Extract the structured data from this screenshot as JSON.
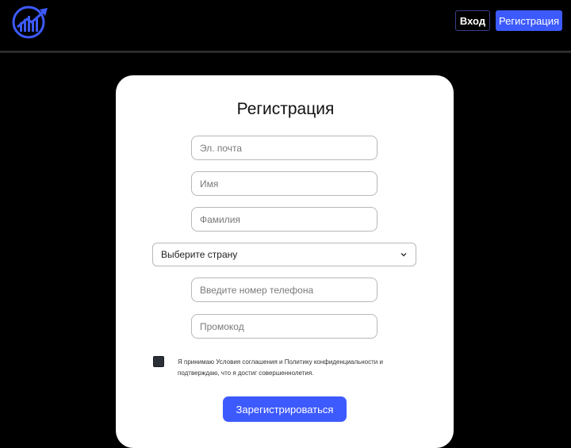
{
  "header": {
    "logo_icon": "chart-growth-logo-icon",
    "login_label": "Вход",
    "register_label": "Регистрация"
  },
  "form": {
    "title": "Регистрация",
    "email_placeholder": "Эл. почта",
    "name_placeholder": "Имя",
    "surname_placeholder": "Фамилия",
    "country_select": {
      "selected": "Выберите страну",
      "icon": "chevron-down-icon"
    },
    "phone_placeholder": "Введите номер телефона",
    "promo_placeholder": "Промокод",
    "terms_line1": "Я принимаю Условия соглашения и Политику конфиденциальности и",
    "terms_line2": "подтверждаю, что я достиг совершеннолетия.",
    "submit_label": "Зарегистрироваться"
  },
  "colors": {
    "accent": "#3d5afe",
    "background": "#000000",
    "card": "#ffffff"
  }
}
